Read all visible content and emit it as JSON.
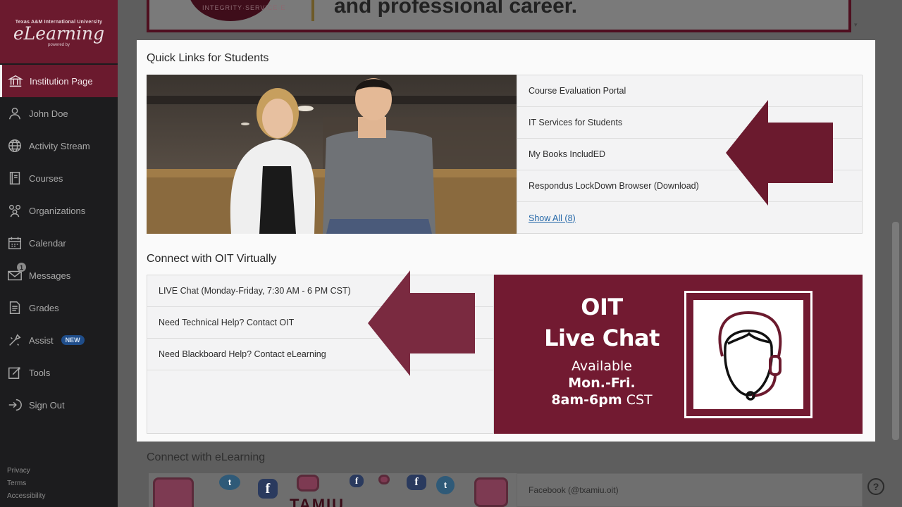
{
  "brand": {
    "university": "Texas A&M International University",
    "logo": "eLearning",
    "powered": "powered by"
  },
  "sidebar": {
    "items": [
      {
        "label": "Institution Page",
        "icon": "institution-icon",
        "active": true
      },
      {
        "label": "John Doe",
        "icon": "user-icon"
      },
      {
        "label": "Activity Stream",
        "icon": "globe-icon"
      },
      {
        "label": "Courses",
        "icon": "book-icon"
      },
      {
        "label": "Organizations",
        "icon": "organizations-icon"
      },
      {
        "label": "Calendar",
        "icon": "calendar-icon"
      },
      {
        "label": "Messages",
        "icon": "envelope-icon",
        "badge": "1"
      },
      {
        "label": "Grades",
        "icon": "grades-icon"
      },
      {
        "label": "Assist",
        "icon": "assist-icon",
        "tag": "NEW"
      },
      {
        "label": "Tools",
        "icon": "tools-icon"
      },
      {
        "label": "Sign Out",
        "icon": "sign-out-icon"
      }
    ],
    "footer": {
      "privacy": "Privacy",
      "terms": "Terms",
      "accessibility": "Accessibility"
    }
  },
  "banner": {
    "text": "and professional career.",
    "seal_text": "INTEGRITY·SERVICE·E"
  },
  "quick_links": {
    "title": "Quick Links for Students",
    "items": [
      {
        "label": "Course Evaluation Portal"
      },
      {
        "label": "IT Services for Students"
      },
      {
        "label": "My Books IncludED"
      },
      {
        "label": "Respondus LockDown Browser (Download)"
      }
    ],
    "show_all": "Show All (8)"
  },
  "connect_oit": {
    "title": "Connect with OIT Virtually",
    "items": [
      {
        "label": "LIVE Chat (Monday-Friday, 7:30 AM - 6 PM CST)"
      },
      {
        "label": "Need Technical Help? Contact OIT"
      },
      {
        "label": "Need Blackboard Help? Contact eLearning"
      }
    ],
    "banner": {
      "line1": "OIT",
      "line2": "Live Chat",
      "line3": "Available",
      "line4": "Mon.-Fri.",
      "line5_bold": "8am-6pm",
      "line5_normal": " CST"
    }
  },
  "connect_elearning": {
    "title": "Connect with eLearning",
    "social_text": "TAMIU",
    "facebook": "Facebook (@txamiu.oit)"
  },
  "help": {
    "label": "?"
  },
  "colors": {
    "maroon": "#721a31",
    "sidebar": "#1c1c1e",
    "link": "#2467a8"
  }
}
